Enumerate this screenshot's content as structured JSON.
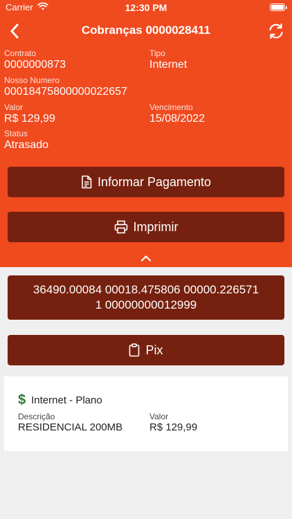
{
  "status_bar": {
    "carrier": "Carrier",
    "time": "12:30 PM"
  },
  "nav": {
    "title": "Cobranças 0000028411"
  },
  "fields": {
    "contrato": {
      "label": "Contrato",
      "value": "0000000873"
    },
    "tipo": {
      "label": "Tipo",
      "value": "Internet"
    },
    "nosso_numero": {
      "label": "Nosso Numero",
      "value": "00018475800000022657"
    },
    "valor": {
      "label": "Valor",
      "value": "R$ 129,99"
    },
    "vencimento": {
      "label": "Vencimento",
      "value": "15/08/2022"
    },
    "status": {
      "label": "Status",
      "value": "Atrasado"
    }
  },
  "actions": {
    "informar_pagamento": "Informar Pagamento",
    "imprimir": "Imprimir",
    "pix": "Pix"
  },
  "barcode": {
    "line1": "36490.00084 00018.475806 00000.226571",
    "line2": "1 00000000012999"
  },
  "item": {
    "title": "Internet - Plano",
    "descricao_label": "Descrição",
    "descricao_value": "RESIDENCIAL 200MB",
    "valor_label": "Valor",
    "valor_value": "R$ 129,99"
  },
  "colors": {
    "header_bg": "#F04A1F",
    "button_bg": "#76210F",
    "page_bg": "#EFEFEF",
    "icon_green": "#2E7D32"
  },
  "icons": {
    "back": "chevron-left-icon",
    "refresh": "refresh-icon",
    "informar": "document-icon",
    "imprimir": "printer-icon",
    "pix": "clipboard-icon",
    "collapse": "chevron-up-icon",
    "item": "dollar-icon"
  }
}
